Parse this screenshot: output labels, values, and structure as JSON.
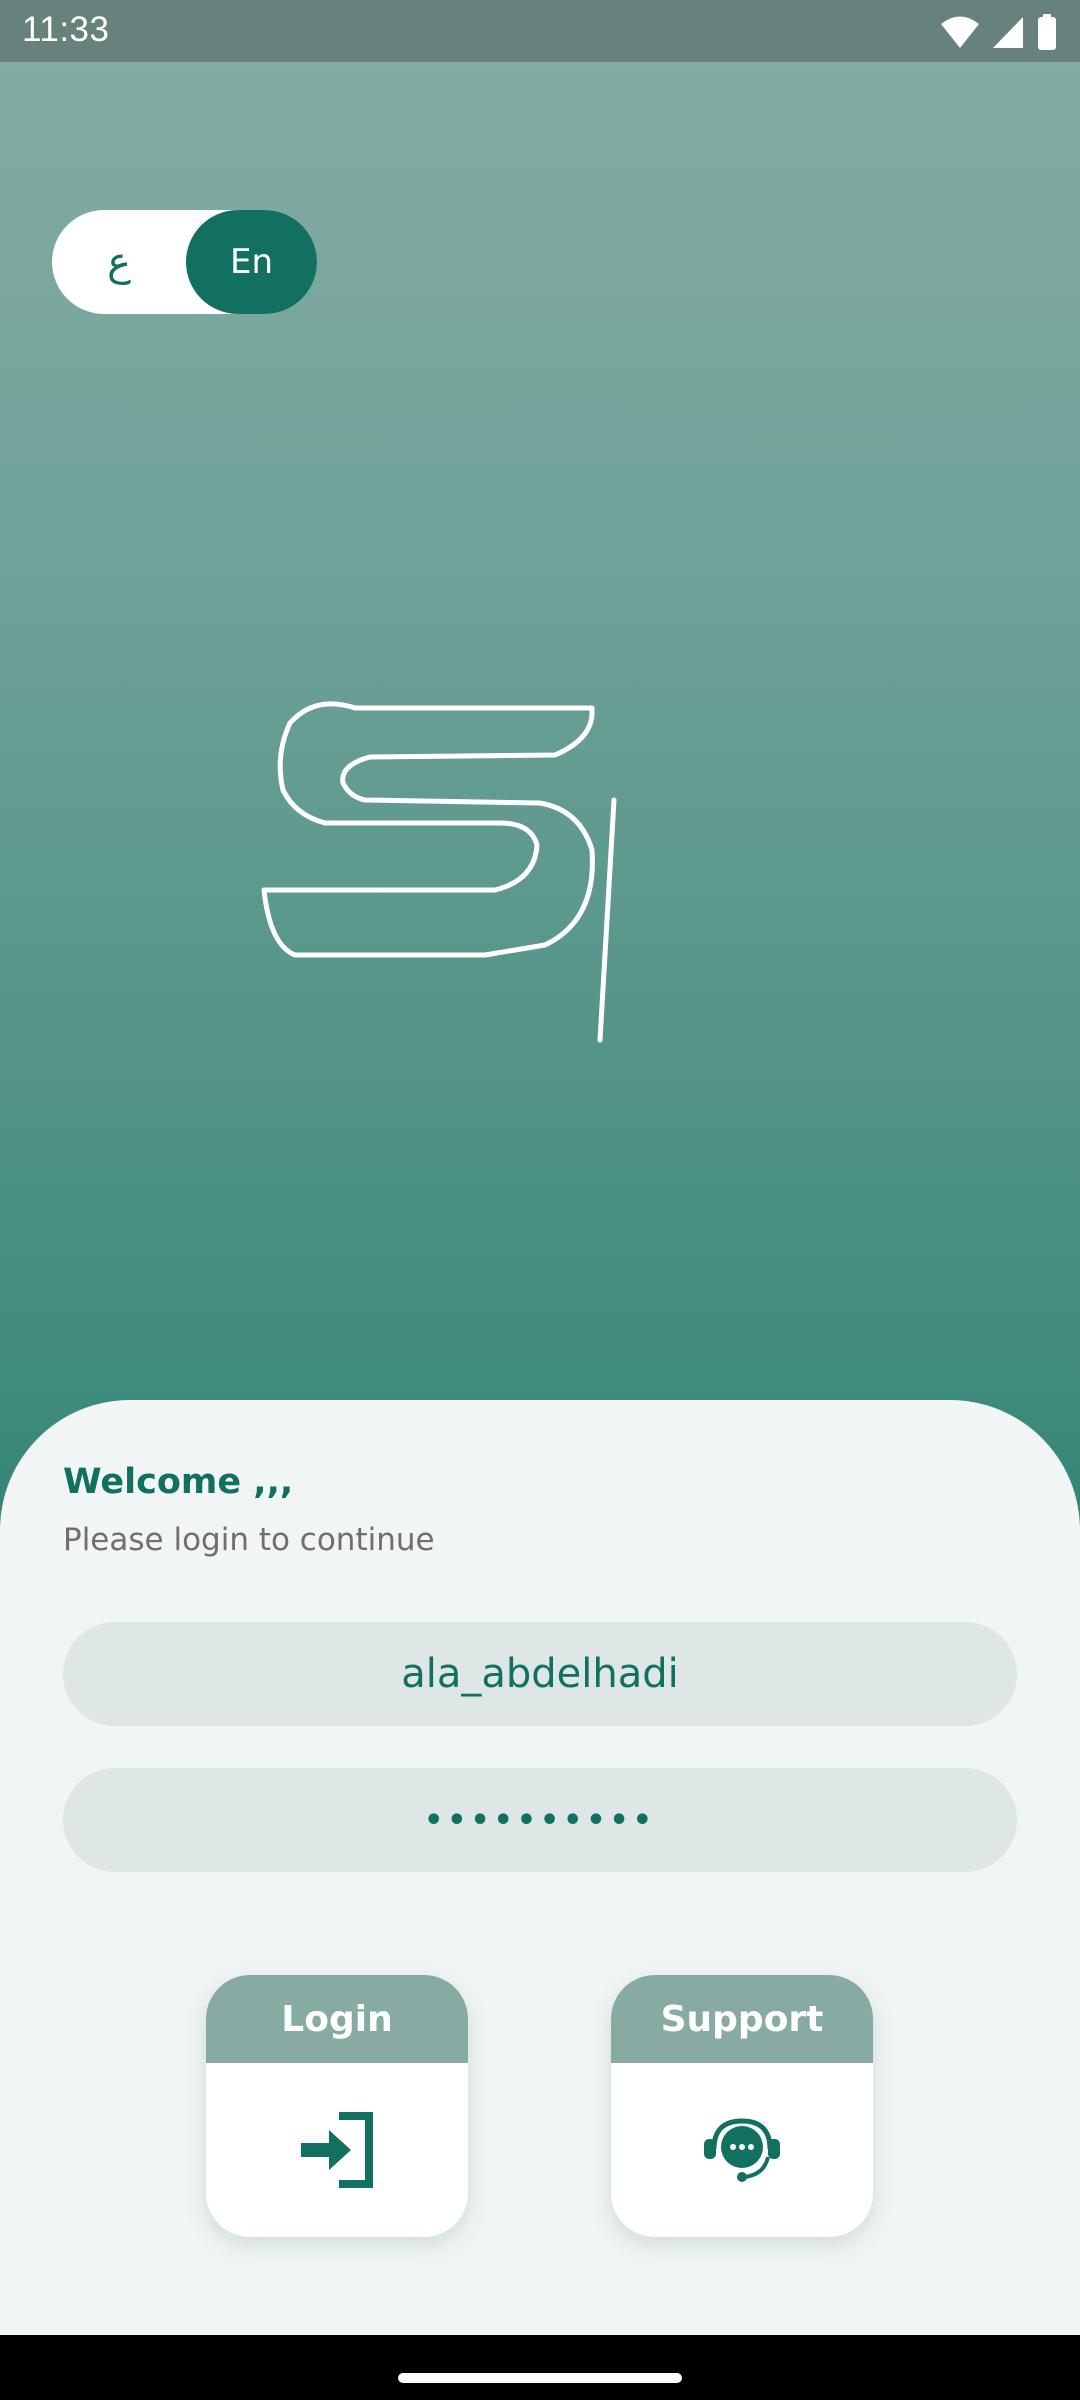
{
  "status_bar": {
    "time": "11:33"
  },
  "language_toggle": {
    "arabic_label": "ع",
    "english_label": "En",
    "selected": "En"
  },
  "logo": {
    "name": "S-logo"
  },
  "login_form": {
    "welcome_title": "Welcome ,,,",
    "welcome_subtitle": "Please login to continue",
    "username_value": "ala_abdelhadi",
    "password_value": "••••••••••"
  },
  "actions": {
    "login_label": "Login",
    "support_label": "Support"
  },
  "colors": {
    "primary": "#11705f",
    "card_header": "#87aba3",
    "field_bg": "#dee7e5",
    "sheet_bg": "#f1f5f4"
  }
}
